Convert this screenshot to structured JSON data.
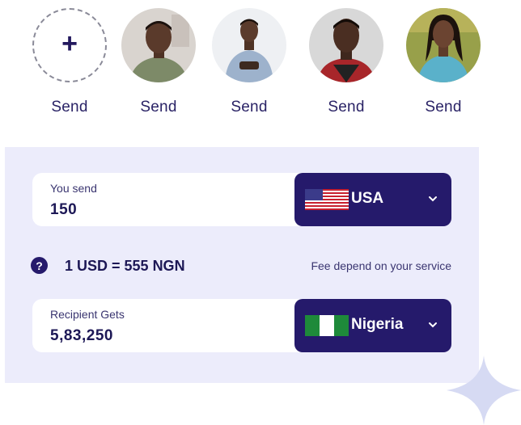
{
  "contacts": {
    "add": {
      "label": "Send",
      "icon": "plus-icon"
    },
    "people": [
      {
        "label": "Send",
        "bg": "#d8d3cf",
        "skin": "#5a3a2b",
        "shirt": "#7c8a6b"
      },
      {
        "label": "Send",
        "bg": "#eef0f3",
        "skin": "#5b3b2c",
        "shirt": "#8fa8c6"
      },
      {
        "label": "Send",
        "bg": "#dcdcdc",
        "skin": "#4a2e22",
        "shirt": "#b0282a"
      },
      {
        "label": "Send",
        "bg": "#9aa04a",
        "skin": "#6b4431",
        "shirt": "#5ab0c9"
      }
    ]
  },
  "converter": {
    "send": {
      "label": "You send",
      "value": "150",
      "currency": "USA",
      "flag": "us-flag-icon"
    },
    "rate": {
      "text": "1 USD = 555 NGN",
      "help_icon": "?",
      "fee": "Fee depend on your service"
    },
    "receive": {
      "label": "Recipient Gets",
      "value": "5,83,250",
      "currency": "Nigeria",
      "flag": "nigeria-flag-icon"
    }
  },
  "colors": {
    "primary": "#251a6b",
    "card_bg": "#ececfb",
    "text": "#1d1856"
  }
}
